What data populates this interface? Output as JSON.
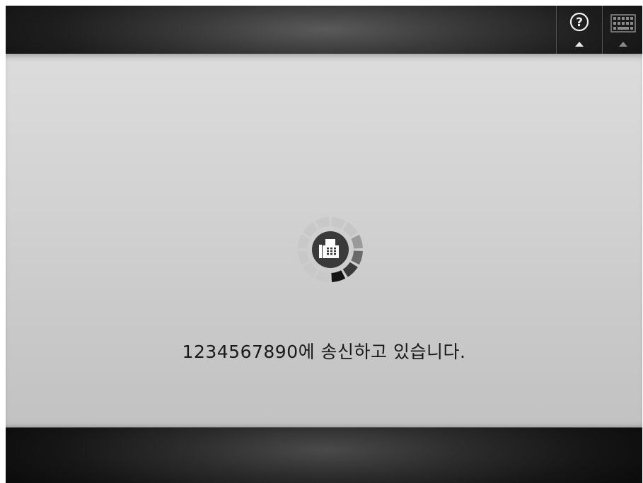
{
  "topbar": {
    "help_button": {
      "icon": "help-icon",
      "label": "?"
    },
    "keyboard_button": {
      "icon": "keyboard-icon"
    }
  },
  "main": {
    "spinner_icon": "fax-icon",
    "status_text": "1234567890에 송신하고 있습니다."
  },
  "colors": {
    "spinner_active": "#1e1e1e",
    "spinner_inactive": "#c4c4c4",
    "spinner_center": "#3a3a3a"
  }
}
